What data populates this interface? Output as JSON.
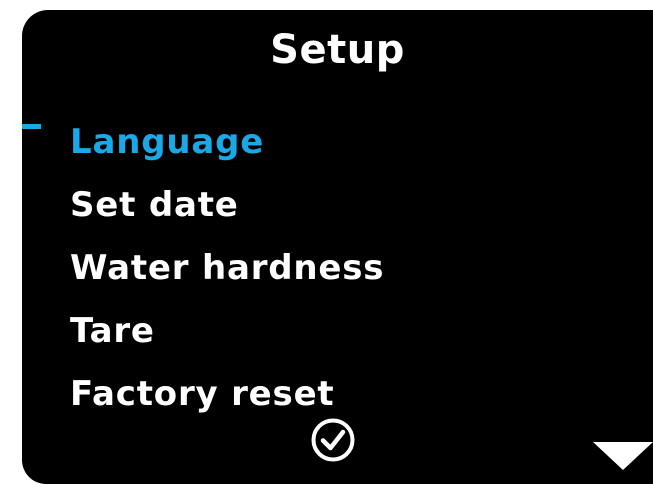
{
  "screen": {
    "title": "Setup",
    "menu": {
      "items": [
        {
          "label": "Language",
          "selected": true
        },
        {
          "label": "Set date",
          "selected": false
        },
        {
          "label": "Water hardness",
          "selected": false
        },
        {
          "label": "Tare",
          "selected": false
        },
        {
          "label": "Factory reset",
          "selected": false
        }
      ]
    },
    "footer": {
      "confirm_icon": "check-circle-icon",
      "scroll_icon": "triangle-down-icon"
    },
    "colors": {
      "background": "#000000",
      "text": "#ffffff",
      "accent": "#1aa8e6"
    }
  }
}
